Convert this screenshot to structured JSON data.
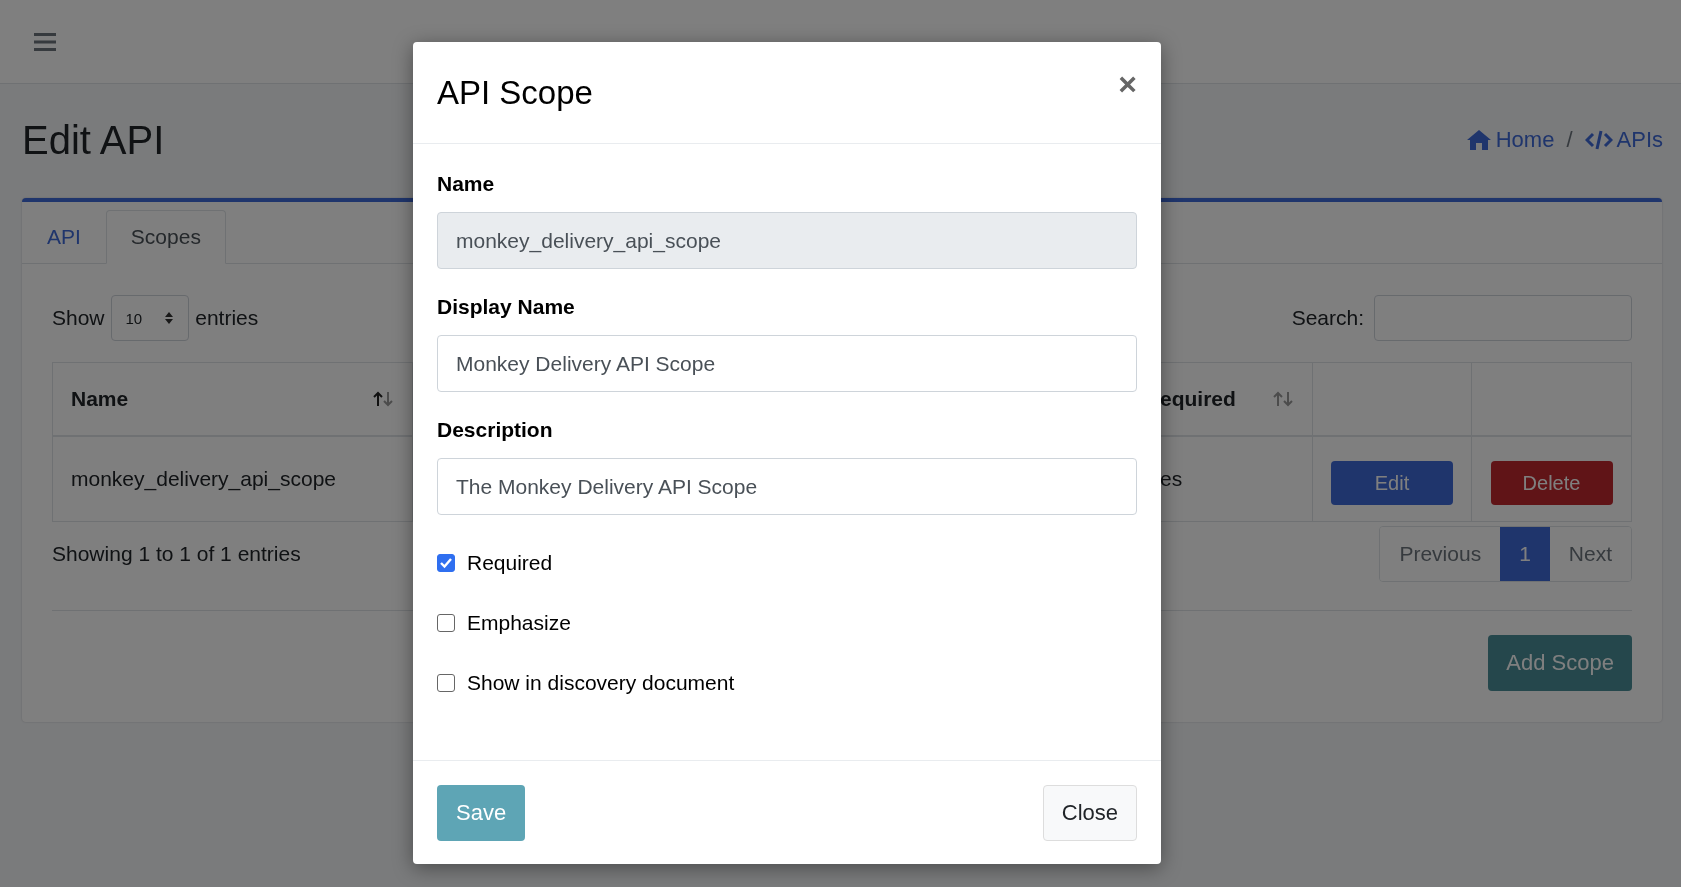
{
  "page": {
    "title": "Edit API",
    "breadcrumb": [
      {
        "label": "Home",
        "kind": "home"
      },
      {
        "label": "APIs",
        "kind": "code"
      }
    ],
    "separator": "/"
  },
  "tabs": [
    {
      "label": "API",
      "selected": false
    },
    {
      "label": "Scopes",
      "selected": true
    }
  ],
  "length_menu": {
    "before": "Show",
    "value": "10",
    "after": "entries"
  },
  "search": {
    "label": "Search:"
  },
  "table": {
    "columns": [
      "Name",
      "equired"
    ],
    "rows": [
      {
        "name": "monkey_delivery_api_scope",
        "required": "es",
        "edit": "Edit",
        "delete": "Delete"
      }
    ]
  },
  "info": "Showing 1 to 1 of 1 entries",
  "pagination": [
    {
      "label": "Previous",
      "selected": false
    },
    {
      "label": "1",
      "selected": true
    },
    {
      "label": "Next",
      "selected": false
    }
  ],
  "add_button": "Add Scope",
  "modal": {
    "title": "API Scope",
    "close_icon": "×",
    "fields": [
      {
        "label": "Name",
        "value": "monkey_delivery_api_scope",
        "disabled": true
      },
      {
        "label": "Display Name",
        "value": "Monkey Delivery API Scope",
        "disabled": false
      },
      {
        "label": "Description",
        "value": "The Monkey Delivery API Scope",
        "disabled": false
      }
    ],
    "checkboxes": [
      {
        "label": "Required",
        "checked": true
      },
      {
        "label": "Emphasize",
        "checked": false
      },
      {
        "label": "Show in discovery document",
        "checked": false
      }
    ],
    "save": "Save",
    "close": "Close"
  }
}
